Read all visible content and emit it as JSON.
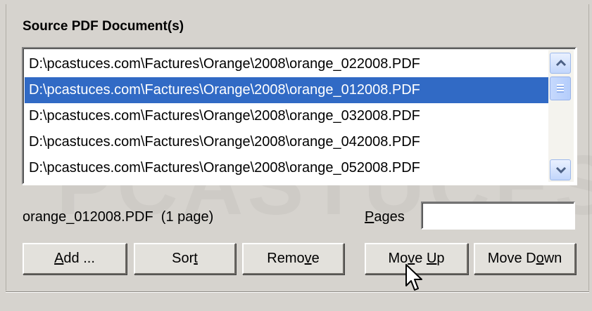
{
  "section_title": "Source PDF Document(s)",
  "files": [
    {
      "path": "D:\\pcastuces.com\\Factures\\Orange\\2008\\orange_022008.PDF",
      "selected": false
    },
    {
      "path": "D:\\pcastuces.com\\Factures\\Orange\\2008\\orange_012008.PDF",
      "selected": true
    },
    {
      "path": "D:\\pcastuces.com\\Factures\\Orange\\2008\\orange_032008.PDF",
      "selected": false
    },
    {
      "path": "D:\\pcastuces.com\\Factures\\Orange\\2008\\orange_042008.PDF",
      "selected": false
    },
    {
      "path": "D:\\pcastuces.com\\Factures\\Orange\\2008\\orange_052008.PDF",
      "selected": false
    }
  ],
  "selection_info": "orange_012008.PDF  (1 page)",
  "pages": {
    "label_before": "",
    "label_accel": "P",
    "label_after": "ages",
    "value": ""
  },
  "buttons": {
    "add": {
      "before": "",
      "accel": "A",
      "after": "dd ..."
    },
    "sort": {
      "before": "Sor",
      "accel": "t",
      "after": ""
    },
    "remove": {
      "before": "Remo",
      "accel": "v",
      "after": "e"
    },
    "move_up": {
      "before": "Mo",
      "accel": "v",
      "after": "e ",
      "accel2": "U",
      "after2": "p"
    },
    "move_down": {
      "before": "Move D",
      "accel": "o",
      "after": "wn"
    }
  },
  "watermark": "PCASTUCES",
  "colors": {
    "selection": "#316ac5",
    "background": "#d6d3ce"
  }
}
